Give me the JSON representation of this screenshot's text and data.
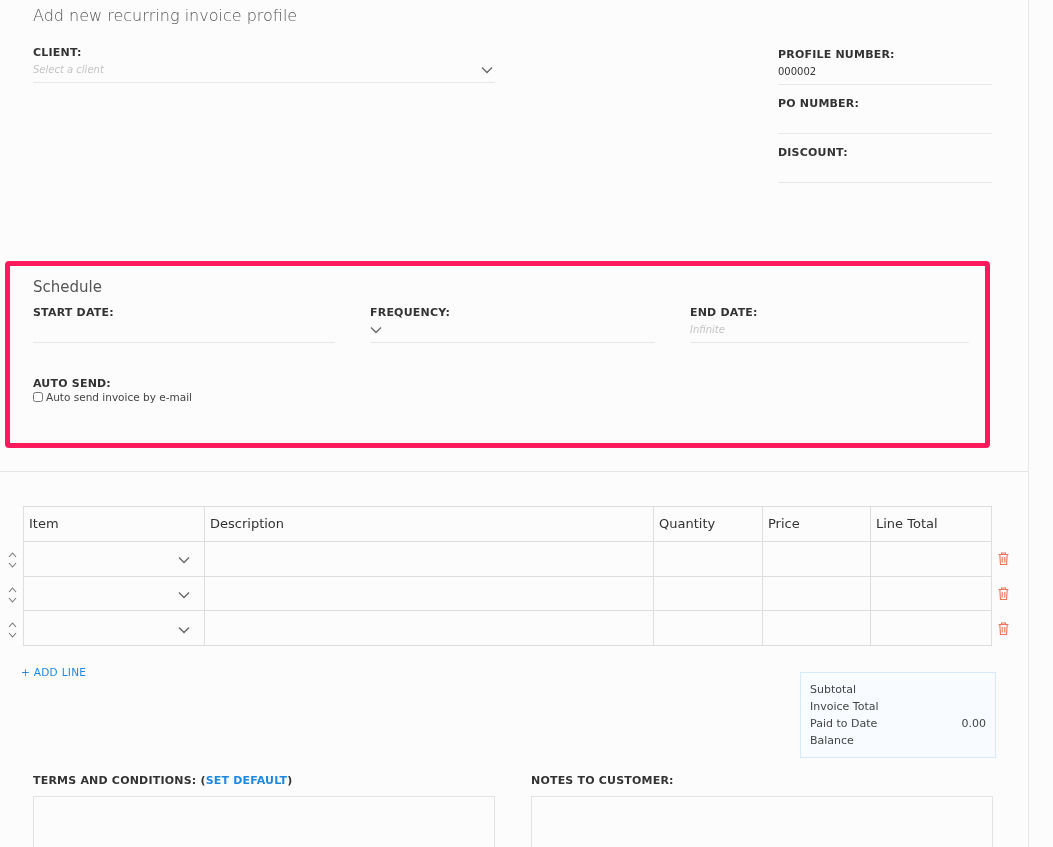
{
  "title": "Add new recurring invoice profile",
  "client": {
    "label": "CLIENT:",
    "placeholder": "Select a client"
  },
  "profile_number": {
    "label": "PROFILE NUMBER:",
    "value": "000002"
  },
  "po_number": {
    "label": "PO NUMBER:"
  },
  "discount": {
    "label": "DISCOUNT:"
  },
  "schedule": {
    "title": "Schedule",
    "start_date": {
      "label": "START DATE:"
    },
    "frequency": {
      "label": "FREQUENCY:"
    },
    "end_date": {
      "label": "END DATE:",
      "placeholder": "Infinite"
    },
    "auto_send": {
      "label": "AUTO SEND:",
      "option": "Auto send invoice by e-mail",
      "checked": false
    }
  },
  "table": {
    "columns": [
      "Item",
      "Description",
      "Quantity",
      "Price",
      "Line Total"
    ],
    "rows": [
      {
        "kind": "line"
      },
      {
        "kind": "line"
      },
      {
        "kind": "line"
      }
    ]
  },
  "add_line": "+ ADD LINE",
  "totals": [
    {
      "label": "Subtotal"
    },
    {
      "label": "Invoice Total"
    },
    {
      "label": "Paid to Date",
      "value": "0.00"
    },
    {
      "label": "Balance"
    }
  ],
  "terms": {
    "label": "TERMS AND CONDITIONS: (",
    "link": "SET DEFAULT",
    "label_end": ")"
  },
  "notes": {
    "label": "NOTES TO CUSTOMER:"
  }
}
